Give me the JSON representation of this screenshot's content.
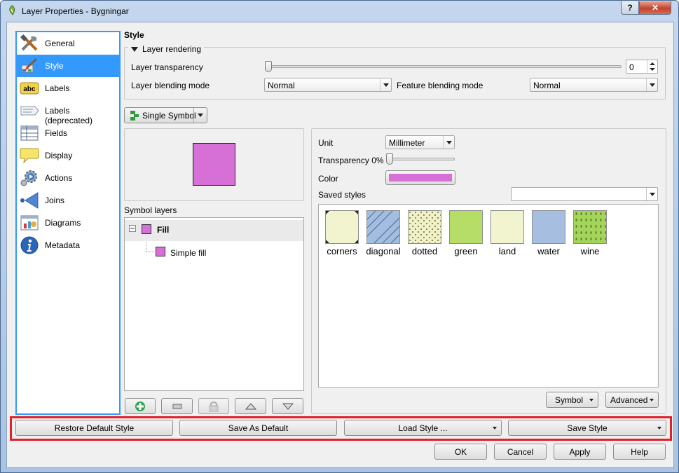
{
  "window": {
    "title": "Layer Properties - Bygningar",
    "help_glyph": "?",
    "close_glyph": "✕"
  },
  "sidebar": {
    "items": [
      {
        "label": "General",
        "icon": "tools-icon"
      },
      {
        "label": "Style",
        "icon": "paintbrush-icon",
        "selected": true
      },
      {
        "label": "Labels",
        "icon": "abc-label-icon"
      },
      {
        "label": "Labels (deprecated)",
        "icon": "label-tag-icon"
      },
      {
        "label": "Fields",
        "icon": "table-icon"
      },
      {
        "label": "Display",
        "icon": "speech-bubble-icon"
      },
      {
        "label": "Actions",
        "icon": "gears-icon"
      },
      {
        "label": "Joins",
        "icon": "join-arrow-icon"
      },
      {
        "label": "Diagrams",
        "icon": "chart-icon"
      },
      {
        "label": "Metadata",
        "icon": "info-icon"
      }
    ]
  },
  "style": {
    "section_title": "Style",
    "rendering": {
      "group_label": "Layer rendering",
      "transparency_label": "Layer transparency",
      "transparency_value": "0",
      "transparency_level": 0,
      "blending_label": "Layer blending mode",
      "blending_value": "Normal",
      "feature_blending_label": "Feature blending mode",
      "feature_blending_value": "Normal"
    },
    "renderer_button": "Single Symbol",
    "symbol_layers_label": "Symbol layers",
    "preview_color": "#d670d6",
    "tree": {
      "root": "Fill",
      "child": "Simple fill"
    },
    "unit_label": "Unit",
    "unit_value": "Millimeter",
    "transparency_label": "Transparency 0%",
    "transparency_level": 0,
    "color_label": "Color",
    "color_value": "#d670d6",
    "saved_styles_label": "Saved styles",
    "saved_styles_value": "",
    "styles": [
      {
        "name": "corners",
        "color": "#f2f3cf"
      },
      {
        "name": "diagonal",
        "color": "#a3bde0"
      },
      {
        "name": "dotted",
        "color": "#f0f1c8"
      },
      {
        "name": "green",
        "color": "#b6dd66"
      },
      {
        "name": "land",
        "color": "#f2f3cf"
      },
      {
        "name": "water",
        "color": "#a6bedf"
      },
      {
        "name": "wine",
        "color": "#a4d45c"
      }
    ],
    "symbol_button": "Symbol",
    "advanced_button": "Advanced"
  },
  "bottom": {
    "restore": "Restore Default Style",
    "save_default": "Save As Default",
    "load_style": "Load Style ...",
    "save_style": "Save Style",
    "ok": "OK",
    "cancel": "Cancel",
    "apply": "Apply",
    "help": "Help"
  },
  "colors": {
    "selection": "#3399ff",
    "highlight_frame": "#e0202a"
  }
}
